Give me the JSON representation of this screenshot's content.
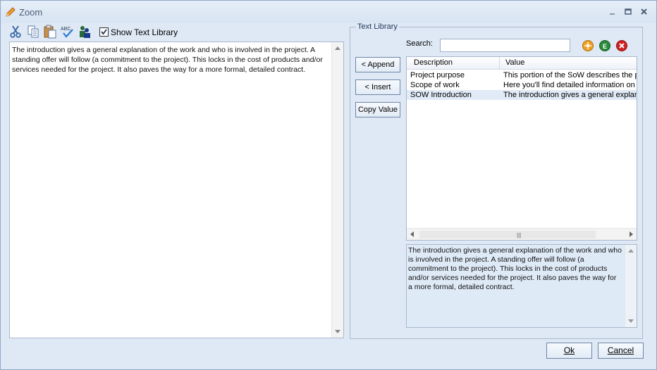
{
  "window": {
    "title": "Zoom",
    "accent_color": "#1f3658"
  },
  "toolbar": {
    "icons": [
      "scissors-icon",
      "copy-icon",
      "paste-icon",
      "spellcheck-icon",
      "users-icon"
    ],
    "show_library_label": "Show Text Library",
    "show_library_checked": true
  },
  "editor": {
    "text": "The introduction gives a general explanation of the work and who is involved in the project. A standing offer will follow (a commitment to the project). This locks in the cost of products and/or services needed for the project. It also paves the way for a more formal, detailed contract."
  },
  "library": {
    "group_title": "Text Library",
    "append_label": "< Append",
    "insert_label": "< Insert",
    "copy_label": "Copy Value",
    "search_label": "Search:",
    "search_value": "",
    "columns": [
      "Description",
      "Value"
    ],
    "rows": [
      {
        "description": "Project purpose",
        "value": "This portion of the SoW describes the pu"
      },
      {
        "description": "Scope of work",
        "value": "Here you'll find detailed information on fu"
      },
      {
        "description": "SOW Introduction",
        "value": "The introduction gives a general explana"
      }
    ],
    "selected_row": 2,
    "preview_text": "The introduction gives a general explanation of the work and who is involved in the project. A standing offer will follow (a commitment to the project). This locks in the cost of products and/or services needed for the project. It also paves the way for a more formal, detailed contract."
  },
  "dialog": {
    "ok_label": "Ok",
    "cancel_label": "Cancel"
  }
}
